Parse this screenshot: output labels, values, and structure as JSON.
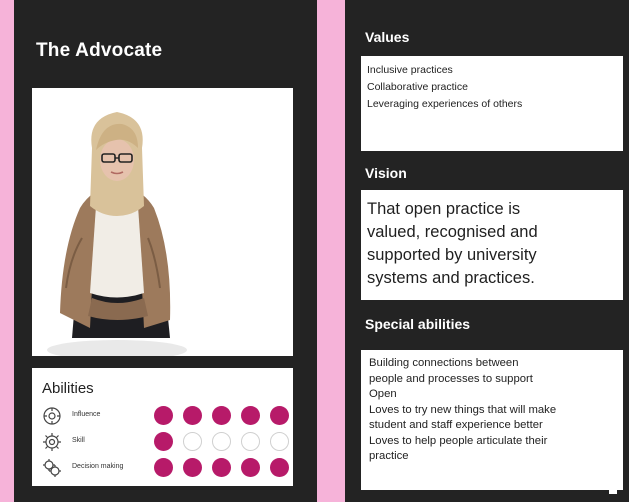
{
  "left_card": {
    "title": "The Advocate",
    "abilities_heading": "Abilities",
    "abilities": [
      {
        "label": "Influence",
        "icon": "influence-icon",
        "filled": 5,
        "total": 5
      },
      {
        "label": "Skill",
        "icon": "skill-icon",
        "filled": 1,
        "total": 5
      },
      {
        "label": "Decision making",
        "icon": "decision-icon",
        "filled": 5,
        "total": 5
      }
    ]
  },
  "right_card": {
    "values_heading": "Values",
    "values": [
      "Inclusive practices",
      "Collaborative practice",
      "Leveraging experiences of others"
    ],
    "vision_heading": "Vision",
    "vision_lines": [
      "That open practice is",
      "valued, recognised and",
      "supported by university",
      "systems and practices."
    ],
    "special_heading": "Special abilities",
    "special_lines": [
      "Building connections between",
      "people and processes to support",
      "Open",
      "Loves to try new things that will make",
      "student and staff experience better",
      "Loves to help people articulate their",
      "practice"
    ]
  },
  "colors": {
    "background": "#f6b3d9",
    "card": "#232323",
    "dot_filled": "#b71a69"
  }
}
